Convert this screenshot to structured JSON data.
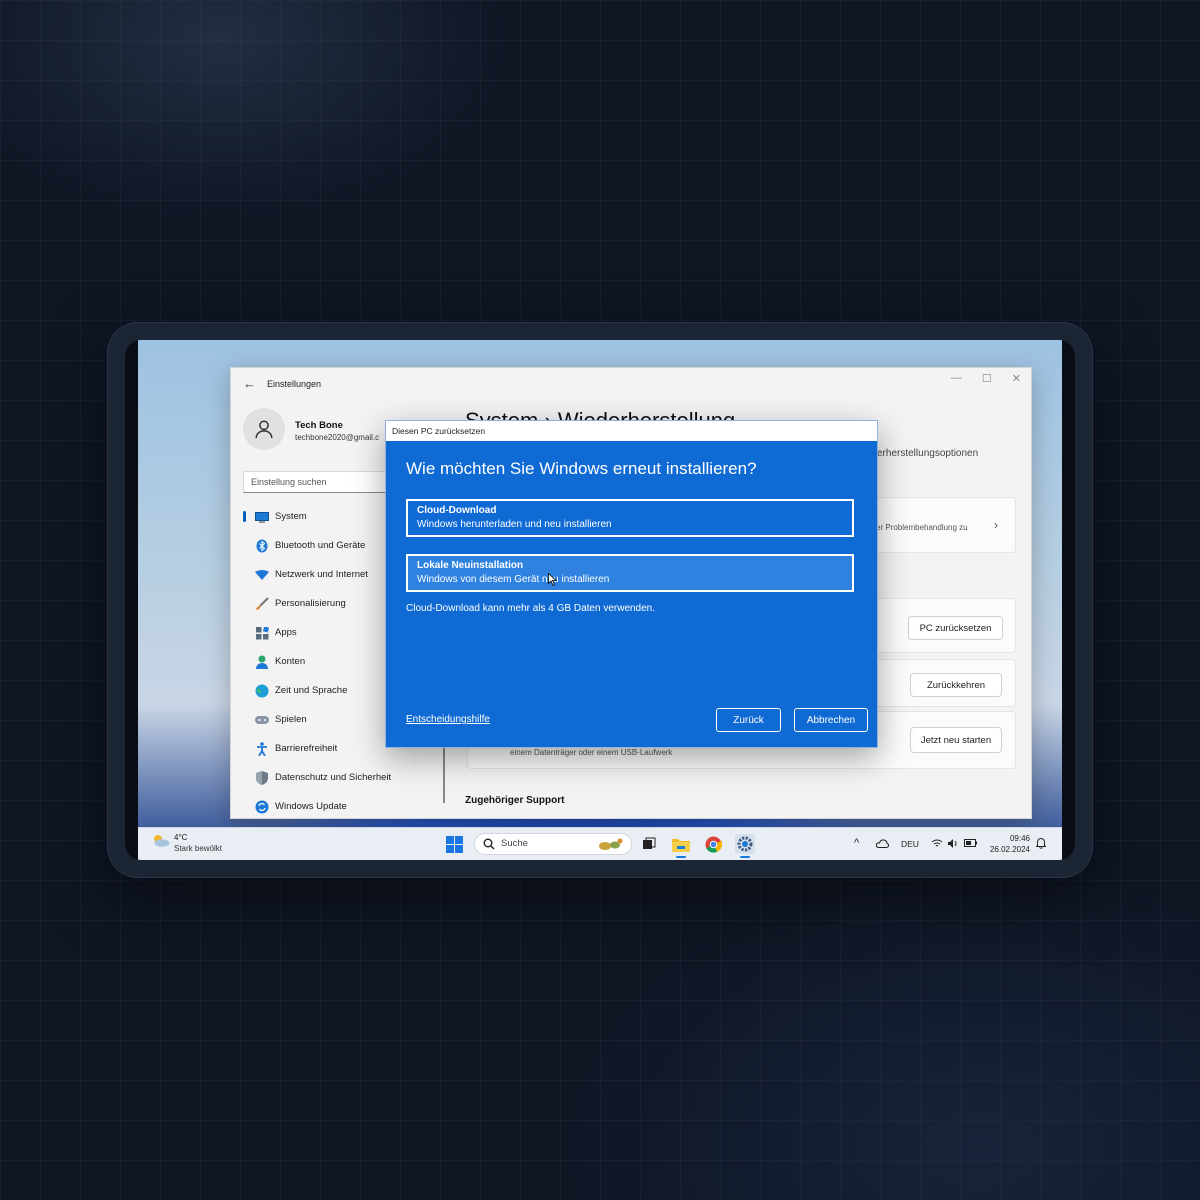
{
  "settings": {
    "window_title": "Einstellungen",
    "profile_name": "Tech Bone",
    "profile_email": "techbone2020@gmail.c",
    "search_placeholder": "Einstellung suchen",
    "breadcrumb": "System  ›  Wiederherstellung",
    "nav": [
      {
        "label": "System",
        "icon": "monitor-icon"
      },
      {
        "label": "Bluetooth und Geräte",
        "icon": "bluetooth-icon"
      },
      {
        "label": "Netzwerk und Internet",
        "icon": "wifi-icon"
      },
      {
        "label": "Personalisierung",
        "icon": "brush-icon"
      },
      {
        "label": "Apps",
        "icon": "apps-icon"
      },
      {
        "label": "Konten",
        "icon": "person-icon"
      },
      {
        "label": "Zeit und Sprache",
        "icon": "globe-clock-icon"
      },
      {
        "label": "Spielen",
        "icon": "gamepad-icon"
      },
      {
        "label": "Barrierefreiheit",
        "icon": "accessibility-icon"
      },
      {
        "label": "Datenschutz und Sicherheit",
        "icon": "shield-icon"
      },
      {
        "label": "Windows Update",
        "icon": "update-icon"
      }
    ],
    "right_partial_heading": "erherstellungsoptionen",
    "troubleshoot_partial": "er Problembehandlung zu",
    "reset_button": "PC zurücksetzen",
    "goback_button": "Zurückkehren",
    "restart_button": "Jetzt neu starten",
    "usb_partial": "einem Datenträger oder einem USB-Laufwerk",
    "support_title": "Zugehöriger Support"
  },
  "dialog": {
    "title": "Diesen PC zurücksetzen",
    "heading": "Wie möchten Sie Windows erneut installieren?",
    "options": [
      {
        "title": "Cloud-Download",
        "desc": "Windows herunterladen und neu installieren"
      },
      {
        "title": "Lokale Neuinstallation",
        "desc": "Windows von diesem Gerät neu installieren"
      }
    ],
    "note": "Cloud-Download kann mehr als 4 GB Daten verwenden.",
    "help_link": "Entscheidungshilfe",
    "back_button": "Zurück",
    "cancel_button": "Abbrechen"
  },
  "taskbar": {
    "weather_temp": "4°C",
    "weather_desc": "Stark bewölkt",
    "search_label": "Suche",
    "language": "DEU",
    "time": "09:46",
    "date": "26.02.2024"
  },
  "colors": {
    "dialog_blue": "#0f6ad4",
    "accent": "#005fb8"
  }
}
